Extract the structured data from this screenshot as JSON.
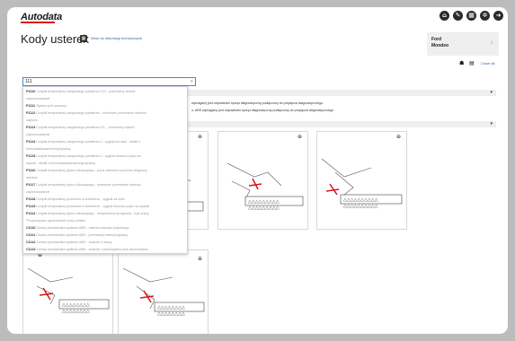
{
  "header": {
    "logo": "Autodata",
    "icons": [
      "home-icon",
      "wrench-icon",
      "calculator-icon",
      "gear-icon",
      "logout-icon"
    ]
  },
  "page": {
    "title": "Kody usterek",
    "tech_link": "Wróć do informacji technicznych"
  },
  "vehicle": {
    "make": "Ford",
    "model": "Mondeo"
  },
  "toolbar": {
    "close_all": "Close all"
  },
  "search": {
    "value": "111",
    "placeholder": ""
  },
  "notes": [
    "wymagany jest odpowiedni sprzęt diagnostyczny podłączony do przyłącza diagnostycznego.",
    "u. ABS wymagany jest odpowiedni sprzęt diagnostyczny podłączony do przyłącza diagnostycznego."
  ],
  "dropdown": [
    {
      "code": "P1110",
      "desc": "Czujnik temperatury zasysanego powietrza C/O - przerwany obwód"
    },
    {
      "code": "",
      "desc": "zapłonu/zwarcie"
    },
    {
      "code": "P1111",
      "desc": "System jest sprawny"
    },
    {
      "code": "P1112",
      "desc": "Czujnik temperatury zasysanego powietrza - okresowe przerwanie obwodu"
    },
    {
      "code": "",
      "desc": "zapłonu"
    },
    {
      "code": "P1113",
      "desc": "Czujnik temperatury zasysanego powietrza C/L - przerwany obwód"
    },
    {
      "code": "",
      "desc": "zapłonu/zwarcie"
    },
    {
      "code": "P1114",
      "desc": "Czujnik temperatury zasysanego powietrza 2 - sygnał za niski - silniki z"
    },
    {
      "code": "",
      "desc": "turbodoładowaniem/sprężarką"
    },
    {
      "code": "P1115",
      "desc": "Czujnik temperatury zasysanego powietrza 2 - sygnał obwodu pojdo za"
    },
    {
      "code": "",
      "desc": "wysoki - silniki z turbodoładowaniem/sprężarką"
    },
    {
      "code": "P1116",
      "desc": "Czujnik temperatury płynu chłodzącego - poza zakresem poziomu diagnozy"
    },
    {
      "code": "",
      "desc": "wiersza"
    },
    {
      "code": "P1117",
      "desc": "Czujnik temperatury płynu chłodzącego - okresowe przerwanie obwodu"
    },
    {
      "code": "",
      "desc": "zapłonu/zwarcie"
    },
    {
      "code": "P1118",
      "desc": "Czujnik temperatury powietrza w kolektorze - sygnał za niski"
    },
    {
      "code": "P1119",
      "desc": "Czujnik temperatury powietrza w kolektorze - sygnał obwodu pojdo za wysoki"
    },
    {
      "code": "P1114",
      "desc": "Czujnik temperatury płynu chłodzącego - temperatura za wysoka - tryb pracy"
    },
    {
      "code": "",
      "desc": "\"Przymusowe ograniczenie mocy silnika\""
    },
    {
      "code": "C1110",
      "desc": "Cewka przekaźnika systemu ABS - usterka obwodu pojdowego"
    },
    {
      "code": "C1111",
      "desc": "Cewka przekaźnika systemu ABS - przerwany obwód pojdowy"
    },
    {
      "code": "C1112",
      "desc": "Cewka przekaźnika systemu ABS - zwarcie z masą"
    },
    {
      "code": "C1113",
      "desc": "Cewka przekaźnika systemu ABS - zwarcie z potencjałem plus akumulatora"
    }
  ],
  "colors": {
    "brand_red": "#d7161d",
    "link_blue": "#2a5db0",
    "focus_blue": "#3d8bd6"
  }
}
